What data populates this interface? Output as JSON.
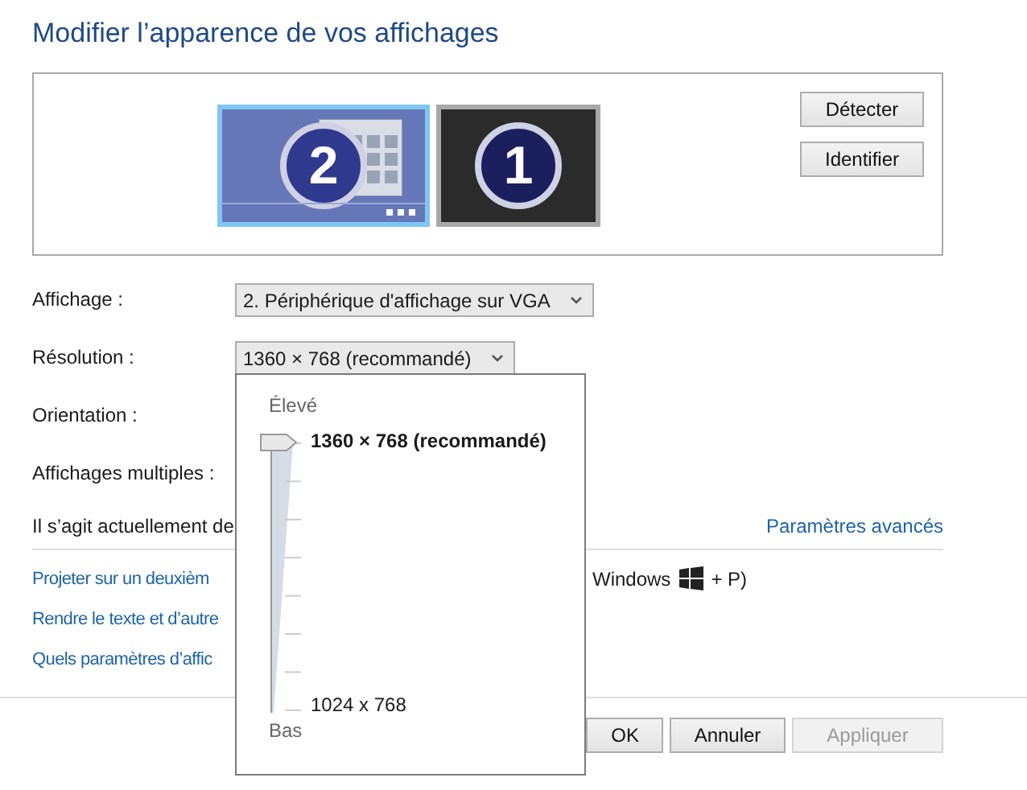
{
  "title": "Modifier l’apparence de vos affichages",
  "monitors": [
    {
      "number": "2",
      "selected": true
    },
    {
      "number": "1",
      "selected": false
    }
  ],
  "side_buttons": [
    "Détecter",
    "Identifier"
  ],
  "settings": [
    {
      "label": "Affichage :",
      "kind": "dropdown",
      "value": "2. Périphérique d'affichage sur VGA"
    },
    {
      "label": "Résolution :",
      "kind": "dropdown",
      "value": "1360 × 768 (recommandé)"
    },
    {
      "label": "Orientation :",
      "kind": "blank"
    },
    {
      "label": "Affichages multiples :",
      "kind": "blank"
    }
  ],
  "status_text": "Il s’agit actuellement de",
  "advanced_link": "Paramètres avancés",
  "links": [
    {
      "text": "Projeter sur un deuxièm",
      "suffix": "Windows",
      "shortcut": "+ P)"
    },
    {
      "text": "Rendre le texte et d’autre"
    },
    {
      "text": "Quels paramètres d’affic"
    }
  ],
  "buttons": [
    {
      "label": "OK",
      "disabled": false
    },
    {
      "label": "Annuler",
      "disabled": false
    },
    {
      "label": "Appliquer",
      "disabled": true
    }
  ],
  "resolution_popup": {
    "top_label": "Élevé",
    "bottom_label": "Bas",
    "max_label": "1360 × 768 (recommandé)",
    "min_label": "1024 x 768",
    "level": 1
  }
}
